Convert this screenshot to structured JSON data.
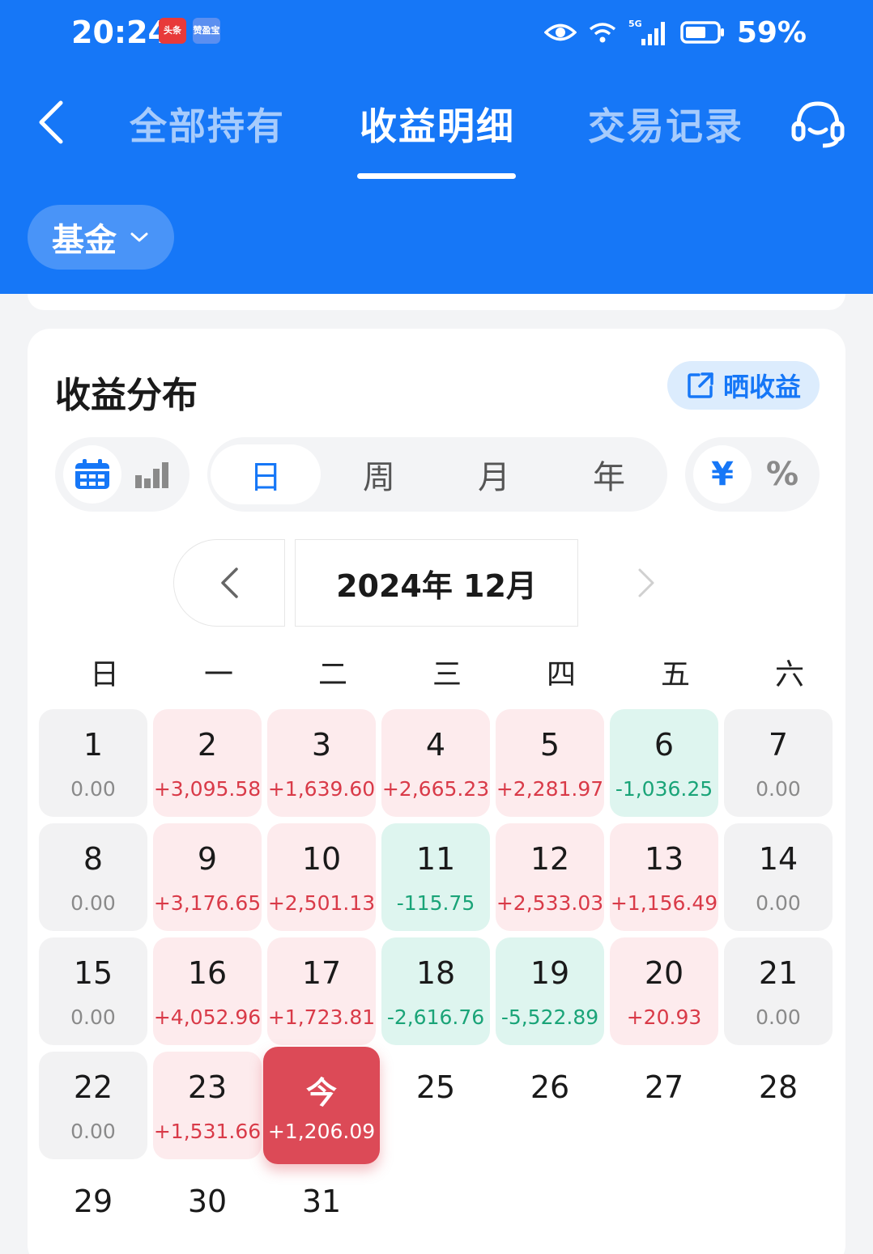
{
  "status_bar": {
    "time": "20:24",
    "app_badge_1": "头条",
    "app_badge_2": "赞盈宝",
    "battery": "59%"
  },
  "nav": {
    "tabs": [
      "全部持有",
      "收益明细",
      "交易记录"
    ],
    "active_tab": "收益明细"
  },
  "filter": {
    "label": "基金"
  },
  "card": {
    "title": "收益分布",
    "share_label": "晒收益",
    "view_modes": [
      "calendar-icon",
      "bar-chart-icon"
    ],
    "periods": [
      "日",
      "周",
      "月",
      "年"
    ],
    "active_period": "日",
    "units": [
      "¥",
      "%"
    ],
    "active_unit": "¥",
    "month": "2024年 12月"
  },
  "calendar": {
    "weekdays": [
      "日",
      "一",
      "二",
      "三",
      "四",
      "五",
      "六"
    ],
    "start_weekday": 0,
    "days": [
      {
        "day": "1",
        "amount": "0.00",
        "status": "gray"
      },
      {
        "day": "2",
        "amount": "+3,095.58",
        "status": "red"
      },
      {
        "day": "3",
        "amount": "+1,639.60",
        "status": "red"
      },
      {
        "day": "4",
        "amount": "+2,665.23",
        "status": "red"
      },
      {
        "day": "5",
        "amount": "+2,281.97",
        "status": "red"
      },
      {
        "day": "6",
        "amount": "-1,036.25",
        "status": "green"
      },
      {
        "day": "7",
        "amount": "0.00",
        "status": "gray"
      },
      {
        "day": "8",
        "amount": "0.00",
        "status": "gray"
      },
      {
        "day": "9",
        "amount": "+3,176.65",
        "status": "red"
      },
      {
        "day": "10",
        "amount": "+2,501.13",
        "status": "red"
      },
      {
        "day": "11",
        "amount": "-115.75",
        "status": "green"
      },
      {
        "day": "12",
        "amount": "+2,533.03",
        "status": "red"
      },
      {
        "day": "13",
        "amount": "+1,156.49",
        "status": "red"
      },
      {
        "day": "14",
        "amount": "0.00",
        "status": "gray"
      },
      {
        "day": "15",
        "amount": "0.00",
        "status": "gray"
      },
      {
        "day": "16",
        "amount": "+4,052.96",
        "status": "red"
      },
      {
        "day": "17",
        "amount": "+1,723.81",
        "status": "red"
      },
      {
        "day": "18",
        "amount": "-2,616.76",
        "status": "green"
      },
      {
        "day": "19",
        "amount": "-5,522.89",
        "status": "green"
      },
      {
        "day": "20",
        "amount": "+20.93",
        "status": "red"
      },
      {
        "day": "21",
        "amount": "0.00",
        "status": "gray"
      },
      {
        "day": "22",
        "amount": "0.00",
        "status": "gray"
      },
      {
        "day": "23",
        "amount": "+1,531.66",
        "status": "red"
      },
      {
        "day": "今",
        "amount": "+1,206.09",
        "status": "today"
      },
      {
        "day": "25",
        "amount": "",
        "status": "none"
      },
      {
        "day": "26",
        "amount": "",
        "status": "none"
      },
      {
        "day": "27",
        "amount": "",
        "status": "none"
      },
      {
        "day": "28",
        "amount": "",
        "status": "none"
      },
      {
        "day": "29",
        "amount": "",
        "status": "none"
      },
      {
        "day": "30",
        "amount": "",
        "status": "none"
      },
      {
        "day": "31",
        "amount": "",
        "status": "none"
      }
    ]
  },
  "colors": {
    "brand_blue": "#1677f7",
    "gain_red": "#d93a48",
    "loss_green": "#1aa478",
    "today_red": "#dc4a57"
  }
}
